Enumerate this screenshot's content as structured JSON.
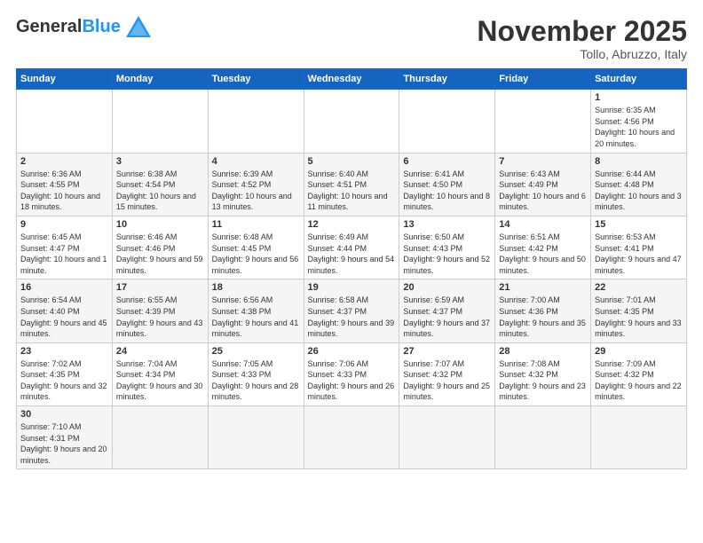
{
  "header": {
    "logo_general": "General",
    "logo_blue": "Blue",
    "month": "November 2025",
    "location": "Tollo, Abruzzo, Italy"
  },
  "days_of_week": [
    "Sunday",
    "Monday",
    "Tuesday",
    "Wednesday",
    "Thursday",
    "Friday",
    "Saturday"
  ],
  "weeks": [
    [
      {
        "day": "",
        "info": ""
      },
      {
        "day": "",
        "info": ""
      },
      {
        "day": "",
        "info": ""
      },
      {
        "day": "",
        "info": ""
      },
      {
        "day": "",
        "info": ""
      },
      {
        "day": "",
        "info": ""
      },
      {
        "day": "1",
        "info": "Sunrise: 6:35 AM\nSunset: 4:56 PM\nDaylight: 10 hours and 20 minutes."
      }
    ],
    [
      {
        "day": "2",
        "info": "Sunrise: 6:36 AM\nSunset: 4:55 PM\nDaylight: 10 hours and 18 minutes."
      },
      {
        "day": "3",
        "info": "Sunrise: 6:38 AM\nSunset: 4:54 PM\nDaylight: 10 hours and 15 minutes."
      },
      {
        "day": "4",
        "info": "Sunrise: 6:39 AM\nSunset: 4:52 PM\nDaylight: 10 hours and 13 minutes."
      },
      {
        "day": "5",
        "info": "Sunrise: 6:40 AM\nSunset: 4:51 PM\nDaylight: 10 hours and 11 minutes."
      },
      {
        "day": "6",
        "info": "Sunrise: 6:41 AM\nSunset: 4:50 PM\nDaylight: 10 hours and 8 minutes."
      },
      {
        "day": "7",
        "info": "Sunrise: 6:43 AM\nSunset: 4:49 PM\nDaylight: 10 hours and 6 minutes."
      },
      {
        "day": "8",
        "info": "Sunrise: 6:44 AM\nSunset: 4:48 PM\nDaylight: 10 hours and 3 minutes."
      }
    ],
    [
      {
        "day": "9",
        "info": "Sunrise: 6:45 AM\nSunset: 4:47 PM\nDaylight: 10 hours and 1 minute."
      },
      {
        "day": "10",
        "info": "Sunrise: 6:46 AM\nSunset: 4:46 PM\nDaylight: 9 hours and 59 minutes."
      },
      {
        "day": "11",
        "info": "Sunrise: 6:48 AM\nSunset: 4:45 PM\nDaylight: 9 hours and 56 minutes."
      },
      {
        "day": "12",
        "info": "Sunrise: 6:49 AM\nSunset: 4:44 PM\nDaylight: 9 hours and 54 minutes."
      },
      {
        "day": "13",
        "info": "Sunrise: 6:50 AM\nSunset: 4:43 PM\nDaylight: 9 hours and 52 minutes."
      },
      {
        "day": "14",
        "info": "Sunrise: 6:51 AM\nSunset: 4:42 PM\nDaylight: 9 hours and 50 minutes."
      },
      {
        "day": "15",
        "info": "Sunrise: 6:53 AM\nSunset: 4:41 PM\nDaylight: 9 hours and 47 minutes."
      }
    ],
    [
      {
        "day": "16",
        "info": "Sunrise: 6:54 AM\nSunset: 4:40 PM\nDaylight: 9 hours and 45 minutes."
      },
      {
        "day": "17",
        "info": "Sunrise: 6:55 AM\nSunset: 4:39 PM\nDaylight: 9 hours and 43 minutes."
      },
      {
        "day": "18",
        "info": "Sunrise: 6:56 AM\nSunset: 4:38 PM\nDaylight: 9 hours and 41 minutes."
      },
      {
        "day": "19",
        "info": "Sunrise: 6:58 AM\nSunset: 4:37 PM\nDaylight: 9 hours and 39 minutes."
      },
      {
        "day": "20",
        "info": "Sunrise: 6:59 AM\nSunset: 4:37 PM\nDaylight: 9 hours and 37 minutes."
      },
      {
        "day": "21",
        "info": "Sunrise: 7:00 AM\nSunset: 4:36 PM\nDaylight: 9 hours and 35 minutes."
      },
      {
        "day": "22",
        "info": "Sunrise: 7:01 AM\nSunset: 4:35 PM\nDaylight: 9 hours and 33 minutes."
      }
    ],
    [
      {
        "day": "23",
        "info": "Sunrise: 7:02 AM\nSunset: 4:35 PM\nDaylight: 9 hours and 32 minutes."
      },
      {
        "day": "24",
        "info": "Sunrise: 7:04 AM\nSunset: 4:34 PM\nDaylight: 9 hours and 30 minutes."
      },
      {
        "day": "25",
        "info": "Sunrise: 7:05 AM\nSunset: 4:33 PM\nDaylight: 9 hours and 28 minutes."
      },
      {
        "day": "26",
        "info": "Sunrise: 7:06 AM\nSunset: 4:33 PM\nDaylight: 9 hours and 26 minutes."
      },
      {
        "day": "27",
        "info": "Sunrise: 7:07 AM\nSunset: 4:32 PM\nDaylight: 9 hours and 25 minutes."
      },
      {
        "day": "28",
        "info": "Sunrise: 7:08 AM\nSunset: 4:32 PM\nDaylight: 9 hours and 23 minutes."
      },
      {
        "day": "29",
        "info": "Sunrise: 7:09 AM\nSunset: 4:32 PM\nDaylight: 9 hours and 22 minutes."
      }
    ],
    [
      {
        "day": "30",
        "info": "Sunrise: 7:10 AM\nSunset: 4:31 PM\nDaylight: 9 hours and 20 minutes."
      },
      {
        "day": "",
        "info": ""
      },
      {
        "day": "",
        "info": ""
      },
      {
        "day": "",
        "info": ""
      },
      {
        "day": "",
        "info": ""
      },
      {
        "day": "",
        "info": ""
      },
      {
        "day": "",
        "info": ""
      }
    ]
  ]
}
